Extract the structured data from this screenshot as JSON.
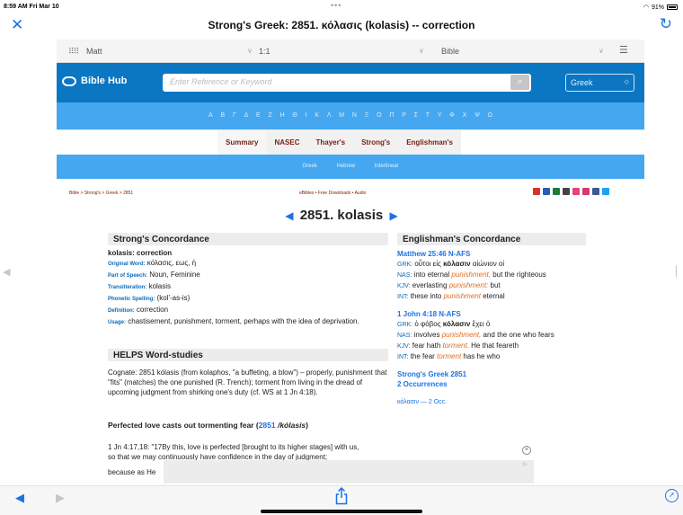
{
  "status": {
    "time": "8:59 AM",
    "date": "Fri Mar 10",
    "battery": "91%"
  },
  "window": {
    "title": "Strong's Greek: 2851. κόλασις (kolasis) -- correction"
  },
  "nav": {
    "book": "Matt",
    "chapter": "1:1",
    "version": "Bible"
  },
  "header": {
    "logo": "Bible Hub",
    "search_placeholder": "Enter Reference or Keyword",
    "language": "Greek"
  },
  "alphabet": [
    "Α",
    "Β",
    "Γ",
    "Δ",
    "Ε",
    "Ζ",
    "Η",
    "Θ",
    "Ι",
    "Κ",
    "Λ",
    "Μ",
    "Ν",
    "Ξ",
    "Ο",
    "Π",
    "Ρ",
    "Σ",
    "Τ",
    "Υ",
    "Φ",
    "Χ",
    "Ψ",
    "Ω"
  ],
  "tabs": [
    "Summary",
    "NASEC",
    "Thayer's",
    "Strong's",
    "Englishman's"
  ],
  "subnav": [
    "Greek",
    "Hebrew",
    "Interlinear"
  ],
  "breadcrumb": "Bible > Strong's > Greek > 2851",
  "ebibles": "eBibles • Free Downloads • Audio",
  "heading": {
    "title": "2851. kolasis",
    "prev": "◀",
    "next": "▶"
  },
  "strongs": {
    "header": "Strong's Concordance",
    "lemma": "kolasis: correction",
    "original_word_label": "Original Word:",
    "original_word": "κόλασις, εως, ἡ",
    "pos_label": "Part of Speech:",
    "pos": "Noun, Feminine",
    "translit_label": "Transliteration:",
    "translit": "kolasis",
    "phonetic_label": "Phonetic Spelling:",
    "phonetic": "(kol'-as-is)",
    "definition_label": "Definition:",
    "definition": "correction",
    "usage_label": "Usage:",
    "usage": "chastisement, punishment, torment, perhaps with the idea of deprivation."
  },
  "helps": {
    "header": "HELPS Word-studies",
    "p1": "Cognate: 2851 kólasis (from kolaphos, \"a buffeting, a blow\") – properly, punishment that \"fits\" (matches) the one punished (R. Trench); torment from living in the dread of upcoming judgment from shirking one's duty (cf. WS at 1 Jn 4:18).",
    "subhead": "Perfected love casts out tormenting fear (",
    "subhead_link": "2851",
    "subhead_word": " /kólasis",
    "subhead_end": ")",
    "p2": "1 Jn 4:17,18: \"17By this, love is perfected [brought to its higher stages] with us, so that we may continuously have confidence in the day of judgment;",
    "p3": "because as He"
  },
  "englishman": {
    "header": "Englishman's Concordance",
    "entries": [
      {
        "ref": "Matthew 25:46 N-AFS",
        "grk": "οὗτοι εἰς κόλασιν αἰώνιον οἱ",
        "nas": "into eternal punishment, but the righteous",
        "kjv": "everlasting punishment: but",
        "int": "these into punishment eternal"
      },
      {
        "ref": "1 John 4:18 N-AFS",
        "grk": "ὁ φόβος κόλασιν ἔχει ὁ",
        "nas": "involves punishment, and the one who fears",
        "kjv": "fear hath torment. He that feareth",
        "int": "the fear torment has he who"
      }
    ],
    "link1": "Strong's Greek 2851",
    "link2": "2 Occurrences",
    "occ": "κόλασιν — 2 Occ."
  },
  "colors": {
    "brand": "#0b76c2",
    "alpha_bar": "#45a7f0",
    "link": "#1a73e8",
    "tab_text": "#7a2212",
    "highlight": "#e06c20"
  }
}
